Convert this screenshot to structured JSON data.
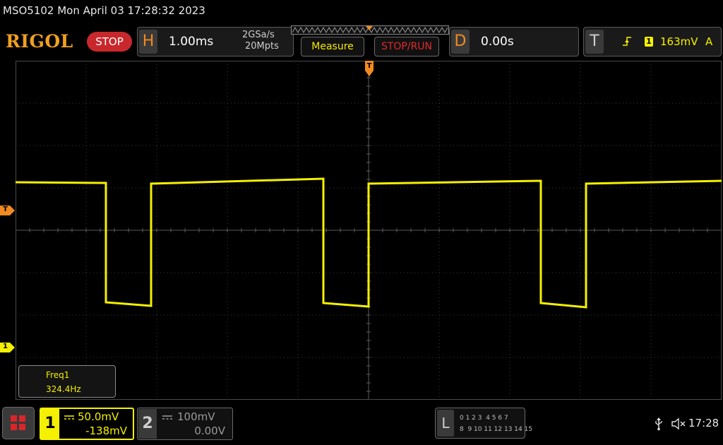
{
  "title": "MSO5102  Mon April 03 17:28:32 2023",
  "brand": {
    "logo": "RIGOL",
    "run_state": "STOP"
  },
  "horizontal": {
    "letter": "H",
    "timebase": "1.00ms",
    "sample_rate": "2GSa/s",
    "memory_depth": "20Mpts"
  },
  "buttons": {
    "measure": "Measure",
    "stop_run": "STOP/RUN"
  },
  "delay": {
    "letter": "D",
    "value": "0.00s"
  },
  "trigger": {
    "letter": "T",
    "channel": "1",
    "level": "163mV",
    "mode": "A"
  },
  "markers": {
    "trigger_top": "T",
    "trigger_left": "T",
    "channel1": "1"
  },
  "measurement": {
    "name": "Freq1",
    "value": "324.4Hz"
  },
  "channel1": {
    "number": "1",
    "scale": "50.0mV",
    "offset": "-138mV"
  },
  "channel2": {
    "number": "2",
    "scale": "100mV",
    "offset": "0.00V"
  },
  "logic": {
    "letter": "L",
    "row1": "0 1 2 3  4 5 6 7",
    "row2": "8  9 10 11 12 13 14 15"
  },
  "status": {
    "time": "17:28"
  },
  "colors": {
    "ch1": "#f5f000",
    "accent": "#f08a20",
    "stop": "#c8282c",
    "grid": "#3c3c3c"
  },
  "icons": {
    "usb": "usb-icon",
    "sound": "speaker-muted-icon",
    "menu": "menu-grid-icon"
  },
  "chart_data": {
    "type": "line",
    "series": [
      {
        "points": [
          [
            0.0,
            0.0
          ]
        ]
      }
    ]
  }
}
